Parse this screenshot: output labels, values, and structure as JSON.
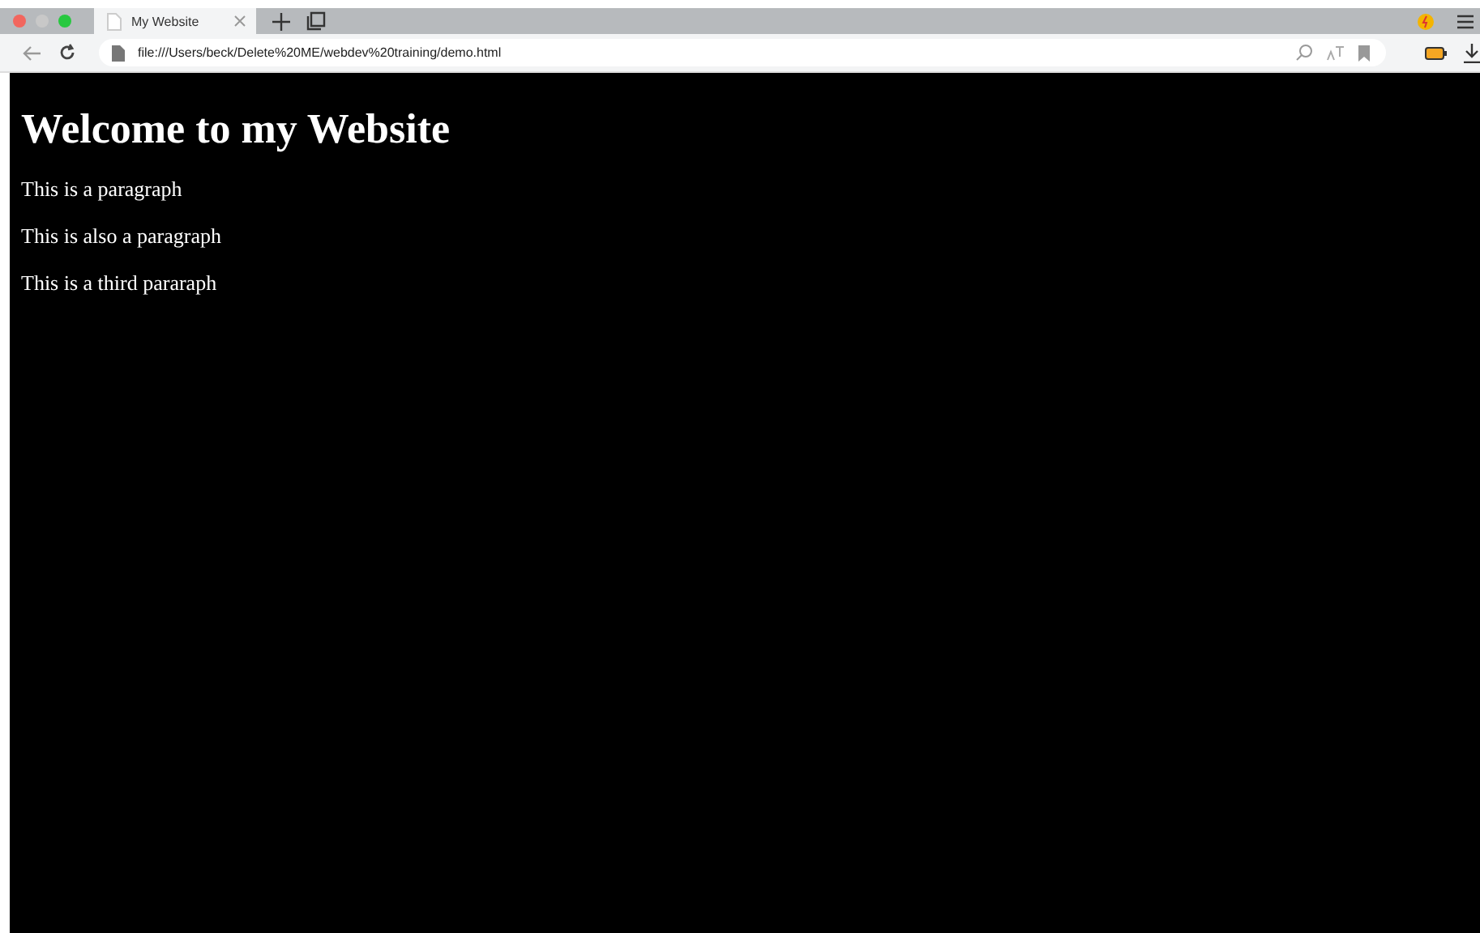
{
  "tabs": [
    {
      "title": "My Website",
      "selected": true
    }
  ],
  "address_bar": {
    "url": "file:///Users/beck/Delete%20ME/webdev%20training/demo.html"
  },
  "page": {
    "heading": "Welcome to my Website",
    "paragraphs": [
      "This is a paragraph",
      "This is also a paragraph",
      "This is a third pararaph"
    ]
  }
}
